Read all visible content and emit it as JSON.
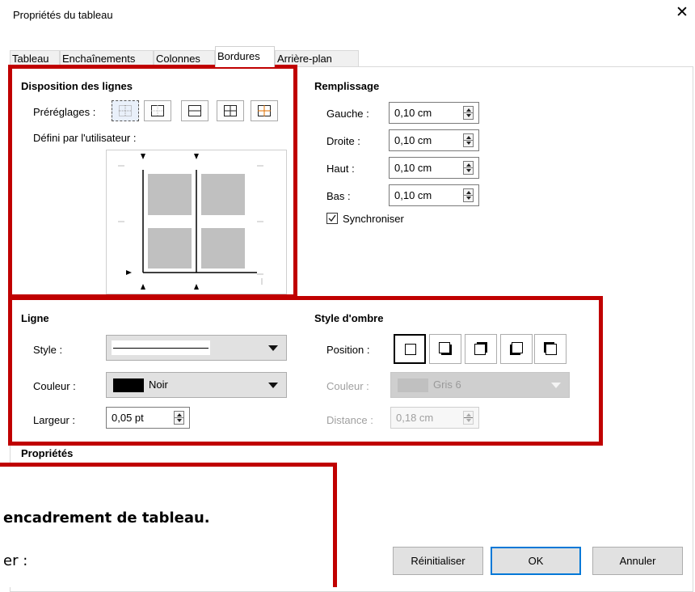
{
  "window": {
    "title": "Propriétés du tableau"
  },
  "tabs": [
    "Tableau",
    "Enchaînements",
    "Colonnes",
    "Bordures",
    "Arrière-plan"
  ],
  "active_tab": "Bordures",
  "line_arrangement": {
    "title": "Disposition des lignes",
    "presets_label": "Préréglages :",
    "user_defined_label": "Défini par l'utilisateur :"
  },
  "padding": {
    "title": "Remplissage",
    "left": {
      "label": "Gauche :",
      "value": "0,10 cm"
    },
    "right": {
      "label": "Droite :",
      "value": "0,10 cm"
    },
    "top": {
      "label": "Haut :",
      "value": "0,10 cm"
    },
    "bottom": {
      "label": "Bas :",
      "value": "0,10 cm"
    },
    "sync_label": "Synchroniser",
    "sync_checked": true
  },
  "line": {
    "title": "Ligne",
    "style_label": "Style :",
    "color_label": "Couleur :",
    "color_value": "Noir",
    "color_swatch": "#000000",
    "width_label": "Largeur :",
    "width_value": "0,05 pt"
  },
  "shadow": {
    "title": "Style d'ombre",
    "position_label": "Position :",
    "color_label": "Couleur :",
    "color_value": "Gris 6",
    "color_swatch": "#c0c0c0",
    "distance_label": "Distance :",
    "distance_value": "0,18 cm"
  },
  "properties": {
    "title": "Propriétés"
  },
  "overlay": {
    "line1": "encadrement de tableau.",
    "line2": "er :",
    "border_color": "#c00000"
  },
  "buttons": {
    "reset": "Réinitialiser",
    "ok": "OK",
    "cancel": "Annuler"
  }
}
